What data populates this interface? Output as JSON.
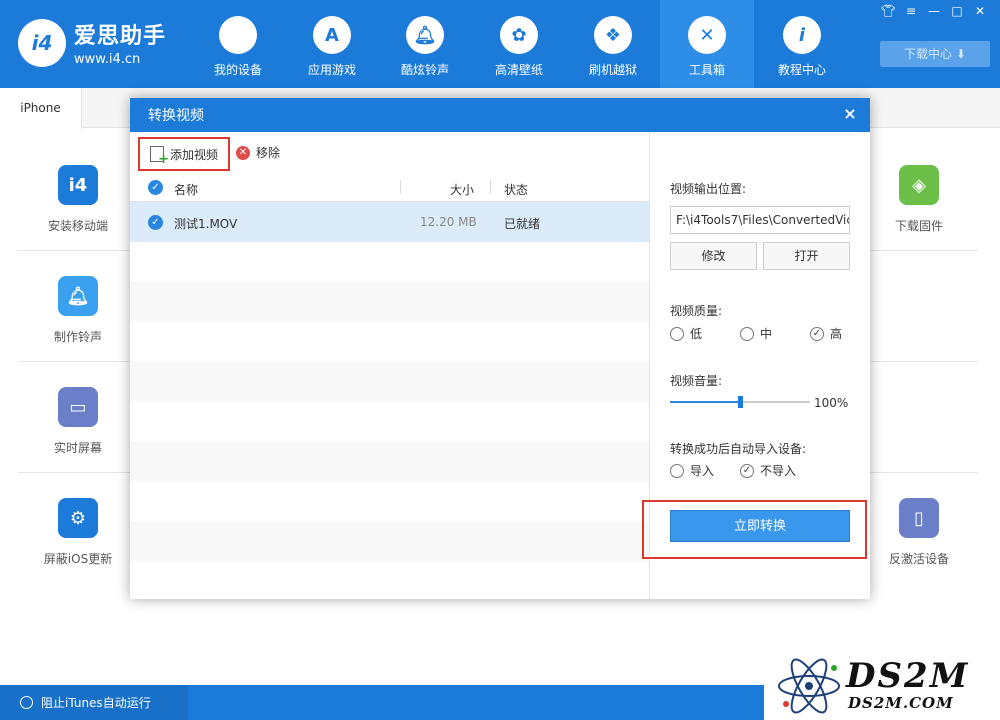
{
  "app": {
    "name": "爱思助手",
    "url": "www.i4.cn",
    "logo_mark": "i4"
  },
  "nav": [
    {
      "label": "我的设备",
      "icon": "apple-icon"
    },
    {
      "label": "应用游戏",
      "icon": "appstore-icon"
    },
    {
      "label": "酷炫铃声",
      "icon": "bell-icon"
    },
    {
      "label": "高清壁纸",
      "icon": "flower-icon"
    },
    {
      "label": "刷机越狱",
      "icon": "box-icon"
    },
    {
      "label": "工具箱",
      "icon": "tools-icon",
      "active": true
    },
    {
      "label": "教程中心",
      "icon": "info-icon"
    }
  ],
  "window_controls": [
    "shirt-icon",
    "menu-icon",
    "minimize-icon",
    "maximize-icon",
    "close-icon"
  ],
  "download_center": "下载中心",
  "device_tab": "iPhone",
  "tools_left": [
    "安装移动端",
    "制作铃声",
    "实时屏幕",
    "屏蔽iOS更新"
  ],
  "tools_right": [
    "下载固件",
    "反激活设备"
  ],
  "status": {
    "itunes_block": "阻止iTunes自动运行"
  },
  "watermark": {
    "big": "DS2M",
    "small": "DS2M.COM"
  },
  "dialog": {
    "title": "转换视频",
    "close": "×",
    "toolbar": {
      "add": "添加视频",
      "remove": "移除"
    },
    "columns": {
      "name": "名称",
      "size": "大小",
      "status": "状态"
    },
    "files": [
      {
        "name": "测试1.MOV",
        "size": "12.20 MB",
        "status": "已就绪",
        "checked": true
      }
    ],
    "settings": {
      "output_label": "视频输出位置:",
      "output_path": "F:\\i4Tools7\\Files\\ConvertedVic",
      "modify": "修改",
      "open": "打开",
      "quality_label": "视频质量:",
      "quality_options": [
        "低",
        "中",
        "高"
      ],
      "quality_selected": "高",
      "volume_label": "视频音量:",
      "volume_value": "100%",
      "volume_fraction": 0.5,
      "auto_import_label": "转换成功后自动导入设备:",
      "import_options": [
        "导入",
        "不导入"
      ],
      "import_selected": "不导入",
      "convert_button": "立即转换"
    }
  },
  "colors": {
    "primary": "#1c7bd9",
    "highlight_red": "#d9392f",
    "row_selected": "#dcebf9",
    "button_blue": "#3a97ee"
  }
}
